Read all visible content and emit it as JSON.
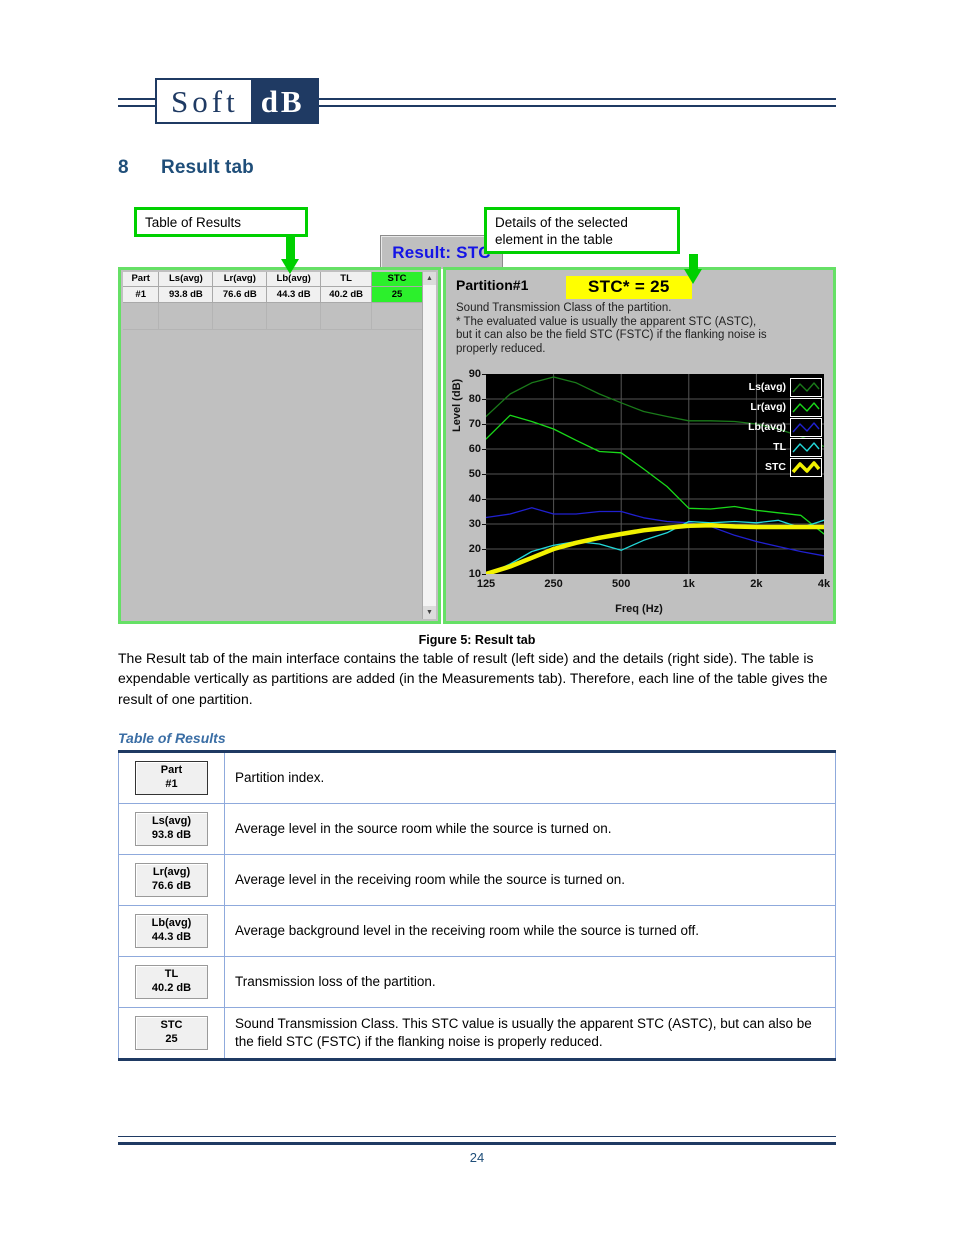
{
  "logo": {
    "part1": "Soft",
    "part2": "dB"
  },
  "heading": {
    "number": "8",
    "title": "Result tab"
  },
  "figure": {
    "callout_left": "Table of Results",
    "callout_right": "Details of the selected element in the table",
    "tab_label": "Result: STC",
    "table": {
      "headers": [
        "Part",
        "Ls(avg)",
        "Lr(avg)",
        "Lb(avg)",
        "TL",
        "STC"
      ],
      "rows": [
        [
          "#1",
          "93.8 dB",
          "76.6 dB",
          "44.3 dB",
          "40.2 dB",
          "25"
        ]
      ]
    },
    "details": {
      "title": "Partition#1",
      "stc_badge": "STC* = 25",
      "description": "Sound Transmission Class of the partition.\n* The evaluated value is usually the apparent STC (ASTC),\nbut it can also be the field STC (FSTC) if the flanking noise is\nproperly reduced."
    },
    "caption": "Figure 5: Result tab"
  },
  "chart_data": {
    "type": "line",
    "title": "",
    "xlabel": "Freq (Hz)",
    "ylabel": "Level (dB)",
    "xlim": [
      125,
      4000
    ],
    "ylim": [
      10,
      90
    ],
    "xscale": "log",
    "grid": true,
    "legend_position": "top-right",
    "xticks": [
      125,
      250,
      500,
      1000,
      2000,
      4000
    ],
    "xticklabels": [
      "125",
      "250",
      "500",
      "1k",
      "2k",
      "4k"
    ],
    "yticks": [
      10,
      20,
      30,
      40,
      50,
      60,
      70,
      80,
      90
    ],
    "yticklabels": [
      "10",
      "20",
      "30",
      "40",
      "50",
      "60",
      "70",
      "80",
      "90"
    ],
    "x": [
      125,
      160,
      200,
      250,
      315,
      400,
      500,
      630,
      800,
      1000,
      1250,
      1600,
      2000,
      2500,
      3150,
      4000
    ],
    "series": [
      {
        "name": "Ls(avg)",
        "color": "#1a7a1a",
        "values": [
          73.0,
          82.0,
          86.5,
          88.8,
          86.5,
          82.0,
          78.5,
          75.0,
          73.0,
          71.3,
          71.3,
          71.0,
          70.0,
          68.0,
          65.0,
          61.0
        ]
      },
      {
        "name": "Lr(avg)",
        "color": "#19d819",
        "values": [
          64.0,
          73.5,
          71.0,
          68.0,
          63.5,
          59.0,
          58.5,
          52.0,
          45.0,
          36.3,
          36.0,
          37.0,
          35.5,
          34.5,
          33.5,
          26.0
        ]
      },
      {
        "name": "Lb(avg)",
        "color": "#2020d0",
        "values": [
          32.6,
          34.0,
          36.5,
          34.0,
          34.0,
          35.0,
          35.0,
          32.5,
          31.0,
          30.5,
          29.0,
          25.5,
          23.0,
          21.0,
          19.0,
          17.3
        ]
      },
      {
        "name": "TL",
        "color": "#22d8d8",
        "values": [
          9.5,
          14.0,
          19.0,
          21.5,
          23.0,
          22.0,
          19.5,
          23.5,
          26.5,
          31.0,
          30.5,
          31.0,
          30.5,
          31.5,
          28.5,
          31.5
        ]
      },
      {
        "name": "STC",
        "color": "#f2f200",
        "values": [
          10.0,
          13.0,
          16.5,
          20.0,
          22.5,
          24.5,
          26.0,
          27.5,
          28.5,
          29.3,
          29.5,
          29.0,
          28.8,
          28.8,
          28.8,
          28.8
        ]
      }
    ]
  },
  "body_paragraph": "The Result tab of the main interface contains the table of result (left side) and the details (right side). The table is expendable vertically as partitions are added (in the Measurements tab). Therefore, each line of the table gives the result of one partition.",
  "sub_heading": "Table of Results",
  "definitions": [
    {
      "chip_top": "Part",
      "chip_bottom": "#1",
      "text": "Partition index."
    },
    {
      "chip_top": "Ls(avg)",
      "chip_bottom": "93.8 dB",
      "text": "Average level in the source room while the source is turned on."
    },
    {
      "chip_top": "Lr(avg)",
      "chip_bottom": "76.6 dB",
      "text": "Average level in the receiving room while the source is turned on."
    },
    {
      "chip_top": "Lb(avg)",
      "chip_bottom": "44.3 dB",
      "text": "Average background level in the receiving room while the source is turned off."
    },
    {
      "chip_top": "TL",
      "chip_bottom": "40.2 dB",
      "text": "Transmission loss of the partition."
    },
    {
      "chip_top": "STC",
      "chip_bottom": "25",
      "text": "Sound Transmission Class. This STC value is usually the apparent STC (ASTC), but can also be the field STC (FSTC) if the flanking noise is properly reduced."
    }
  ],
  "footer": {
    "page_number": "24"
  },
  "colors": {
    "brand": "#1f3a63",
    "heading": "#1f4e79",
    "callout": "#00d000",
    "highlight": "#2cf02c",
    "badge": "#ffff00"
  }
}
